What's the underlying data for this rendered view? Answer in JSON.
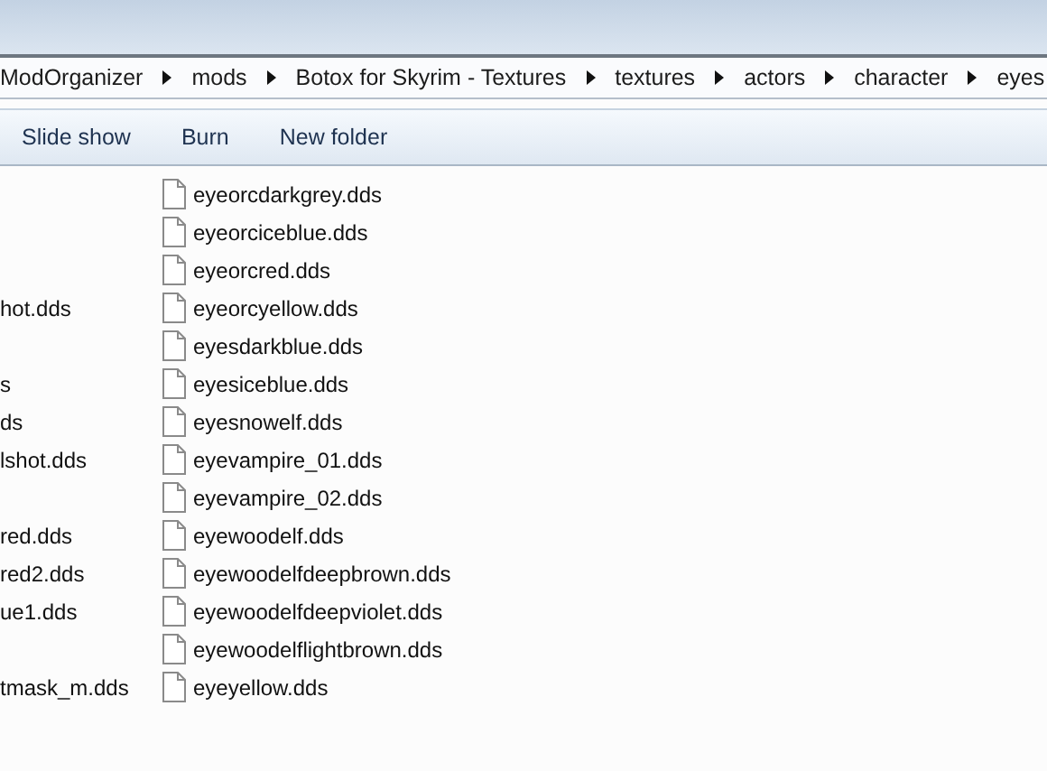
{
  "address_bar": {
    "crumbs": [
      "ModOrganizer",
      "mods",
      "Botox for Skyrim - Textures",
      "textures",
      "actors",
      "character",
      "eyes"
    ]
  },
  "toolbar": {
    "buttons": [
      "Slide show",
      "Burn",
      "New folder"
    ]
  },
  "left_column": [
    {
      "kind": "blank"
    },
    {
      "kind": "blank"
    },
    {
      "kind": "blank"
    },
    {
      "kind": "file",
      "name": "hot.dds"
    },
    {
      "kind": "blank"
    },
    {
      "kind": "file",
      "name": "s"
    },
    {
      "kind": "file",
      "name": "ds"
    },
    {
      "kind": "file",
      "name": "lshot.dds"
    },
    {
      "kind": "blank"
    },
    {
      "kind": "file",
      "name": "red.dds"
    },
    {
      "kind": "file",
      "name": "red2.dds"
    },
    {
      "kind": "file",
      "name": "ue1.dds"
    },
    {
      "kind": "blank"
    },
    {
      "kind": "file",
      "name": "tmask_m.dds"
    }
  ],
  "files": [
    "eyeorcdarkgrey.dds",
    "eyeorciceblue.dds",
    "eyeorcred.dds",
    "eyeorcyellow.dds",
    "eyesdarkblue.dds",
    "eyesiceblue.dds",
    "eyesnowelf.dds",
    "eyevampire_01.dds",
    "eyevampire_02.dds",
    "eyewoodelf.dds",
    "eyewoodelfdeepbrown.dds",
    "eyewoodelfdeepviolet.dds",
    "eyewoodelflightbrown.dds",
    "eyeyellow.dds"
  ]
}
